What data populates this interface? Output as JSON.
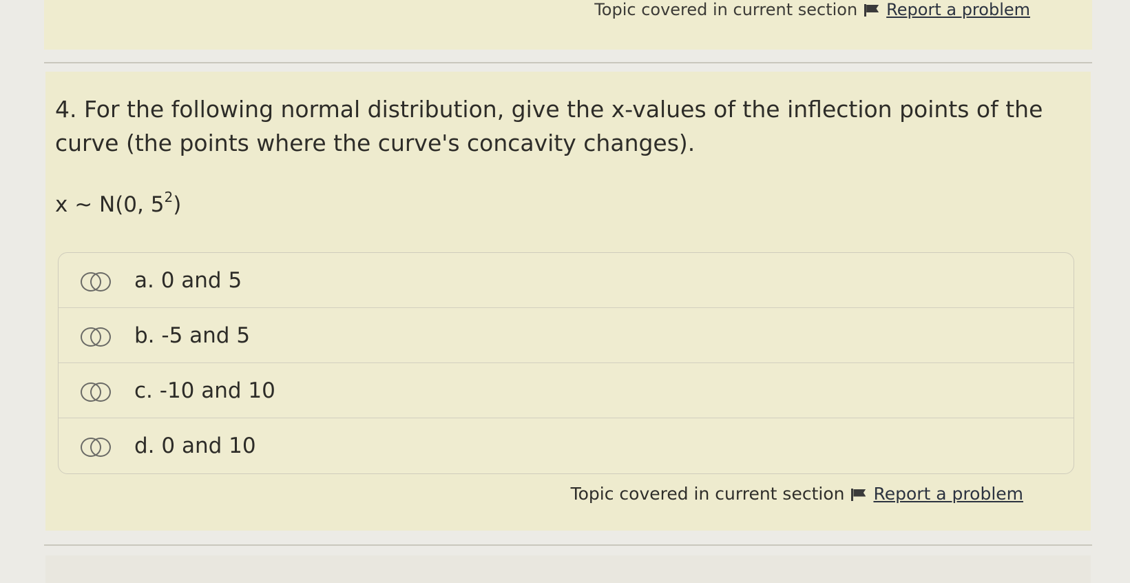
{
  "top_footer": {
    "topic_text": "Topic covered in current section",
    "report_label": "Report a problem"
  },
  "question": {
    "text": "4. For the following normal distribution, give the x-values of the inflection points of the curve (the points where the curve's concavity changes).",
    "formula_base": "x ~ N(0, 5",
    "formula_exponent": "2",
    "formula_close": ")"
  },
  "options": [
    {
      "label": "a. 0 and 5"
    },
    {
      "label": "b. -5 and 5"
    },
    {
      "label": "c. -10 and 10"
    },
    {
      "label": "d. 0 and 10"
    }
  ],
  "footer": {
    "topic_text": "Topic covered in current section",
    "report_label": "Report a problem"
  },
  "icons": {
    "flag": "flag-icon",
    "radio": "radio-circle-icon"
  }
}
